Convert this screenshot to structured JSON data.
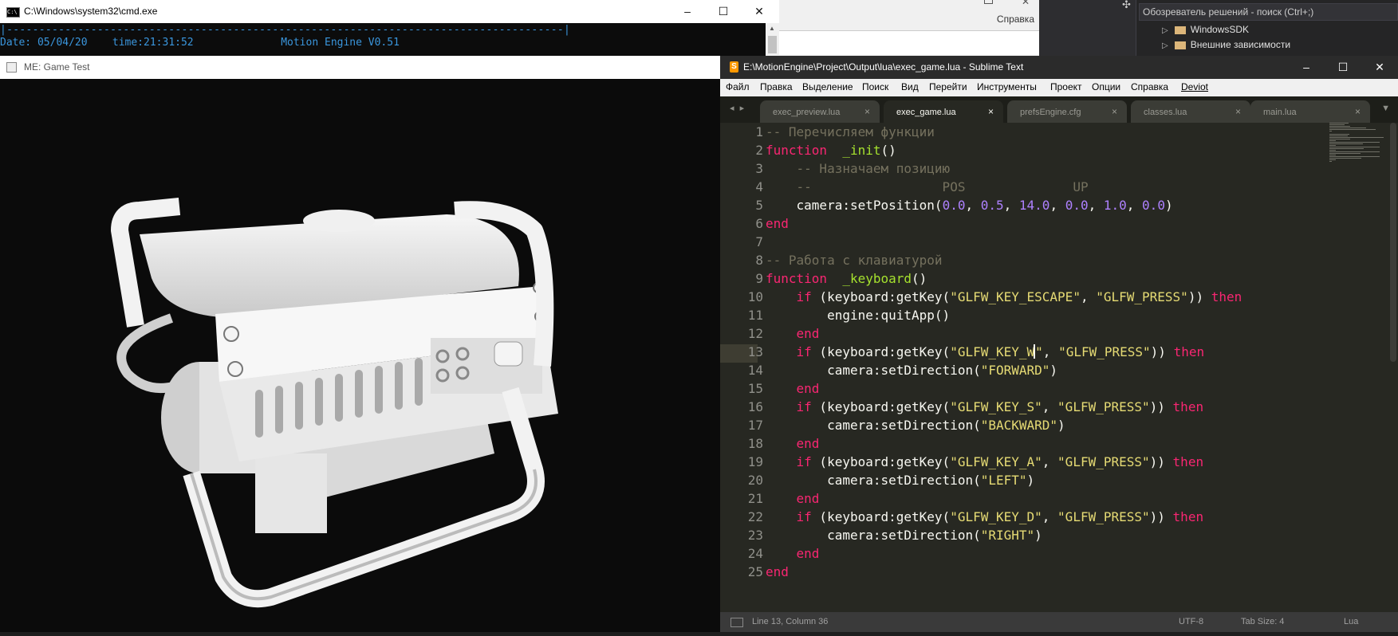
{
  "cmd": {
    "title": "C:\\Windows\\system32\\cmd.exe",
    "icon": "cmd-icon",
    "line_dashes": "|--------------------------------------------------------------------------------------|",
    "line_info": "Date: 05/04/20    time:21:31:52              Motion Engine V0.51"
  },
  "vs": {
    "menu_help": "Справка",
    "search_placeholder": "Обозреватель решений - поиск (Ctrl+;)",
    "tree": [
      "WindowsSDK",
      "Внешние зависимости"
    ]
  },
  "game": {
    "title": "ME: Game Test",
    "icon": "window-icon"
  },
  "window_controls": {
    "minimize": "–",
    "maximize": "☐",
    "close": "✕"
  },
  "sublime": {
    "title": "E:\\MotionEngine\\Project\\Output\\lua\\exec_game.lua - Sublime Text",
    "icon": "sublime-icon",
    "menu": [
      "Файл",
      "Правка",
      "Выделение",
      "Поиск",
      "Вид",
      "Перейти",
      "Инструменты",
      "Проект",
      "Опции",
      "Справка",
      "Deviot"
    ],
    "tabs": [
      {
        "label": "exec_preview.lua",
        "active": false
      },
      {
        "label": "exec_game.lua",
        "active": true
      },
      {
        "label": "prefsEngine.cfg",
        "active": false
      },
      {
        "label": "classes.lua",
        "active": false
      },
      {
        "label": "main.lua",
        "active": false
      }
    ],
    "tab_close": "×",
    "tab_nav": "◂ ▸",
    "tab_dropdown": "▼",
    "current_line": 13,
    "status": {
      "position": "Line 13, Column 36",
      "encoding": "UTF-8",
      "tab_size": "Tab Size: 4",
      "syntax": "Lua"
    },
    "colors": {
      "background": "#272822",
      "keyword": "#f92672",
      "function": "#a6e22e",
      "number": "#ae81ff",
      "string": "#e6db74",
      "comment": "#75715e"
    }
  },
  "code_lines": [
    [
      [
        "cmt",
        "-- Перечисляем функции"
      ]
    ],
    [
      [
        "kw",
        "function"
      ],
      [
        "",
        "  "
      ],
      [
        "fn",
        "_init"
      ],
      [
        "",
        "()"
      ]
    ],
    [
      [
        "",
        "    "
      ],
      [
        "cmt",
        "-- Назначаем позицию"
      ]
    ],
    [
      [
        "",
        "    "
      ],
      [
        "cmt",
        "--                 POS              UP"
      ]
    ],
    [
      [
        "",
        "    camera:setPosition("
      ],
      [
        "num",
        "0.0"
      ],
      [
        "",
        ", "
      ],
      [
        "num",
        "0.5"
      ],
      [
        "",
        ", "
      ],
      [
        "num",
        "14.0"
      ],
      [
        "",
        ", "
      ],
      [
        "num",
        "0.0"
      ],
      [
        "",
        ", "
      ],
      [
        "num",
        "1.0"
      ],
      [
        "",
        ", "
      ],
      [
        "num",
        "0.0"
      ],
      [
        "",
        ")"
      ]
    ],
    [
      [
        "kw",
        "end"
      ]
    ],
    [],
    [
      [
        "cmt",
        "-- Работа с клавиатурой"
      ]
    ],
    [
      [
        "kw",
        "function"
      ],
      [
        "",
        "  "
      ],
      [
        "fn",
        "_keyboard"
      ],
      [
        "",
        "()"
      ]
    ],
    [
      [
        "",
        "    "
      ],
      [
        "kw",
        "if"
      ],
      [
        "",
        " (keyboard:getKey("
      ],
      [
        "str",
        "\"GLFW_KEY_ESCAPE\""
      ],
      [
        "",
        ", "
      ],
      [
        "str",
        "\"GLFW_PRESS\""
      ],
      [
        "",
        "))"
      ],
      [
        "",
        " "
      ],
      [
        "kw",
        "then"
      ]
    ],
    [
      [
        "",
        "        engine:quitApp()"
      ]
    ],
    [
      [
        "",
        "    "
      ],
      [
        "kw",
        "end"
      ]
    ],
    [
      [
        "",
        "    "
      ],
      [
        "kw",
        "if"
      ],
      [
        "",
        " (keyboard:getKey("
      ],
      [
        "str",
        "\"GLFW_KEY_W"
      ],
      [
        "caret",
        ""
      ],
      [
        "str",
        "\""
      ],
      [
        "",
        ", "
      ],
      [
        "str",
        "\"GLFW_PRESS\""
      ],
      [
        "",
        "))"
      ],
      [
        "",
        " "
      ],
      [
        "kw",
        "then"
      ]
    ],
    [
      [
        "",
        "        camera:setDirection("
      ],
      [
        "str",
        "\"FORWARD\""
      ],
      [
        "",
        ")"
      ]
    ],
    [
      [
        "",
        "    "
      ],
      [
        "kw",
        "end"
      ]
    ],
    [
      [
        "",
        "    "
      ],
      [
        "kw",
        "if"
      ],
      [
        "",
        " (keyboard:getKey("
      ],
      [
        "str",
        "\"GLFW_KEY_S\""
      ],
      [
        "",
        ", "
      ],
      [
        "str",
        "\"GLFW_PRESS\""
      ],
      [
        "",
        "))"
      ],
      [
        "",
        " "
      ],
      [
        "kw",
        "then"
      ]
    ],
    [
      [
        "",
        "        camera:setDirection("
      ],
      [
        "str",
        "\"BACKWARD\""
      ],
      [
        "",
        ")"
      ]
    ],
    [
      [
        "",
        "    "
      ],
      [
        "kw",
        "end"
      ]
    ],
    [
      [
        "",
        "    "
      ],
      [
        "kw",
        "if"
      ],
      [
        "",
        " (keyboard:getKey("
      ],
      [
        "str",
        "\"GLFW_KEY_A\""
      ],
      [
        "",
        ", "
      ],
      [
        "str",
        "\"GLFW_PRESS\""
      ],
      [
        "",
        "))"
      ],
      [
        "",
        " "
      ],
      [
        "kw",
        "then"
      ]
    ],
    [
      [
        "",
        "        camera:setDirection("
      ],
      [
        "str",
        "\"LEFT\""
      ],
      [
        "",
        ")"
      ]
    ],
    [
      [
        "",
        "    "
      ],
      [
        "kw",
        "end"
      ]
    ],
    [
      [
        "",
        "    "
      ],
      [
        "kw",
        "if"
      ],
      [
        "",
        " (keyboard:getKey("
      ],
      [
        "str",
        "\"GLFW_KEY_D\""
      ],
      [
        "",
        ", "
      ],
      [
        "str",
        "\"GLFW_PRESS\""
      ],
      [
        "",
        "))"
      ],
      [
        "",
        " "
      ],
      [
        "kw",
        "then"
      ]
    ],
    [
      [
        "",
        "        camera:setDirection("
      ],
      [
        "str",
        "\"RIGHT\""
      ],
      [
        "",
        ")"
      ]
    ],
    [
      [
        "",
        "    "
      ],
      [
        "kw",
        "end"
      ]
    ],
    [
      [
        "kw",
        "end"
      ]
    ]
  ]
}
